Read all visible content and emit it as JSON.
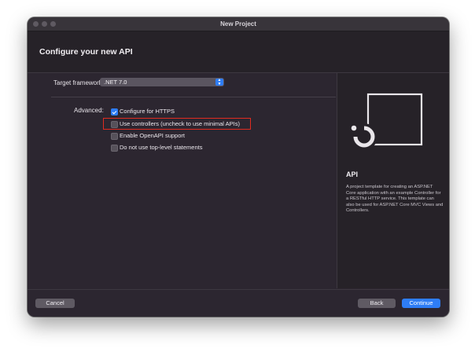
{
  "window": {
    "title": "New Project"
  },
  "header": {
    "title": "Configure your new API"
  },
  "form": {
    "target_framework_label": "Target framework:",
    "target_framework_value": ".NET 7.0",
    "advanced_label": "Advanced:",
    "options": [
      {
        "label": "Configure for HTTPS",
        "checked": true
      },
      {
        "label": "Use controllers (uncheck to use minimal APIs)",
        "checked": false,
        "highlighted": true
      },
      {
        "label": "Enable OpenAPI support",
        "checked": false
      },
      {
        "label": "Do not use top-level statements",
        "checked": false
      }
    ]
  },
  "template": {
    "icon": "api-template-icon",
    "title": "API",
    "description": "A project template for creating an ASP.NET Core application with an example Controller for a RESTful HTTP service. This template can also be used for ASP.NET Core MVC Views and Controllers."
  },
  "footer": {
    "cancel_label": "Cancel",
    "back_label": "Back",
    "continue_label": "Continue"
  },
  "colors": {
    "accent": "#2e7df6",
    "highlight_box": "#e02b20",
    "window_bg": "#2c2630"
  }
}
